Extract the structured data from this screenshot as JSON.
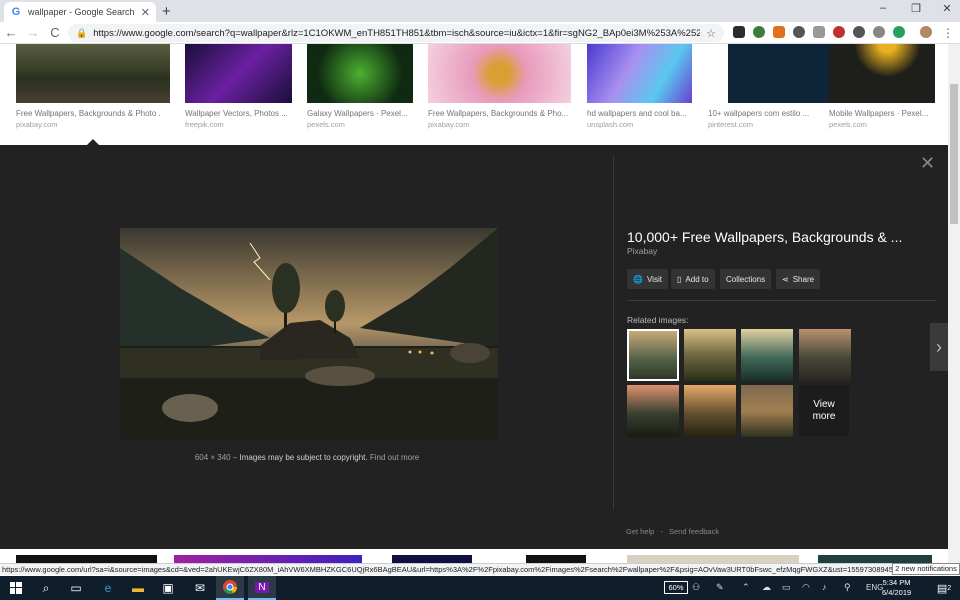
{
  "browser": {
    "tab_title": "wallpaper - Google Search",
    "tab_close": "✕",
    "new_tab": "+",
    "win_minimize": "–",
    "win_maximize": "❐",
    "win_close": "✕",
    "back": "←",
    "forward": "→",
    "reload": "C",
    "url": "https://www.google.com/search?q=wallpaper&rlz=1C1OKWM_enTH851TH851&tbm=isch&source=iu&ictx=1&fir=sgNG2_BAp0ei3M%253A%252CbckAO52...",
    "menu": "⋮"
  },
  "thumbnails": [
    {
      "caption": "Free Wallpapers, Backgrounds & Photo ...",
      "domain": "pixabay.com",
      "color": "#3a4530"
    },
    {
      "caption": "Wallpaper Vectors, Photos ...",
      "domain": "freepik.com",
      "color": "#1a0f3a"
    },
    {
      "caption": "Galaxy Wallpapers · Pexel...",
      "domain": "pexels.com",
      "color": "#0f2a10"
    },
    {
      "caption": "Free Wallpapers, Backgrounds & Pho...",
      "domain": "pixabay.com",
      "color": "#e89aba"
    },
    {
      "caption": "hd wallpapers and cool ba...",
      "domain": "unsplash.com",
      "color": "#7a6ae0"
    },
    {
      "caption": "10+ wallpapers com estilo ...",
      "domain": "pinterest.com",
      "color": "#0e2438"
    },
    {
      "caption": "Mobile Wallpapers · Pexel...",
      "domain": "pexels.com",
      "color": "#1e1e1a"
    }
  ],
  "viewer": {
    "title": "10,000+ Free Wallpapers, Backgrounds & ...",
    "source": "Pixabay",
    "close": "✕",
    "dims": "604 × 340",
    "dash": " – ",
    "copyright": "Images may be subject to copyright.",
    "find_out": "Find out more",
    "buttons": {
      "visit": "Visit",
      "add_to": "Add to",
      "collections": "Collections",
      "share": "Share"
    },
    "related_label": "Related images:",
    "view_more_1": "View",
    "view_more_2": "more",
    "next": "›",
    "get_help": "Get help",
    "send_feedback": "Send feedback"
  },
  "status_url": "https://www.google.com/url?sa=i&source=images&cd=&ved=2ahUKEwjC6ZX80M_iAhVW6XMBHZKGC6UQjRx6BAgBEAU&url=https%3A%2F%2Fpixabay.com%2Fimages%2Fsearch%2Fwallpaper%2F&psig=AOvVaw3URT0bFswc_efzMqgFWGXZ&ust=1559730894521166",
  "notifications": "2 new notifications",
  "taskbar": {
    "battery": "60%",
    "language": "ENG",
    "time": "5:34 PM",
    "date": "6/4/2019",
    "notif_count": "2"
  }
}
